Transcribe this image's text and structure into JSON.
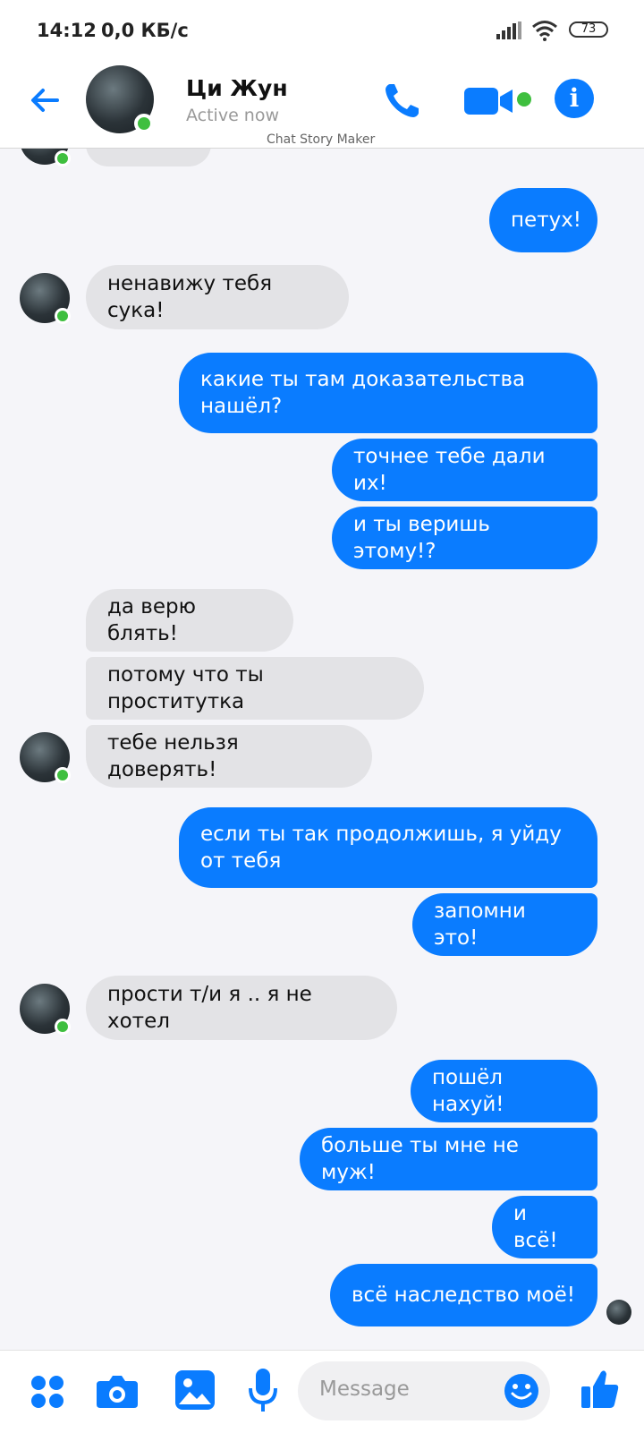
{
  "status_bar": {
    "time": "14:12",
    "speed": "0,0 КБ/с",
    "battery": "73"
  },
  "header": {
    "name": "Ци Жун",
    "status": "Active now",
    "watermark": "Chat Story Maker"
  },
  "messages": [
    {
      "side": "out",
      "text": "петух!"
    },
    {
      "side": "in",
      "text": "ненавижу тебя сука!"
    },
    {
      "side": "out",
      "text": "какие ты там доказательства\nнашёл?"
    },
    {
      "side": "out",
      "text": "точнее тебе дали их!"
    },
    {
      "side": "out",
      "text": "и ты веришь этому!?"
    },
    {
      "side": "in",
      "text": "да верю блять!"
    },
    {
      "side": "in",
      "text": "потому что ты проститутка"
    },
    {
      "side": "in",
      "text": "тебе нельзя доверять!"
    },
    {
      "side": "out",
      "text": "если ты так продолжишь, я уйду\nот тебя"
    },
    {
      "side": "out",
      "text": "запомни это!"
    },
    {
      "side": "in",
      "text": "прости т/и я .. я не хотел"
    },
    {
      "side": "out",
      "text": "пошёл нахуй!"
    },
    {
      "side": "out",
      "text": "больше ты мне не муж!"
    },
    {
      "side": "out",
      "text": "и всё!"
    },
    {
      "side": "out",
      "text": "всё наследство моё!"
    }
  ],
  "composer": {
    "placeholder": "Message"
  },
  "colors": {
    "accent": "#0a7cff",
    "incoming": "#e3e3e6",
    "online": "#3fbf3f"
  },
  "icons": {
    "back": "arrow-left-icon",
    "call": "phone-icon",
    "video": "video-camera-icon",
    "info": "info-icon",
    "menu": "four-dots-icon",
    "camera": "camera-icon",
    "gallery": "image-icon",
    "mic": "microphone-icon",
    "emoji": "smile-icon",
    "like": "thumbs-up-icon"
  }
}
